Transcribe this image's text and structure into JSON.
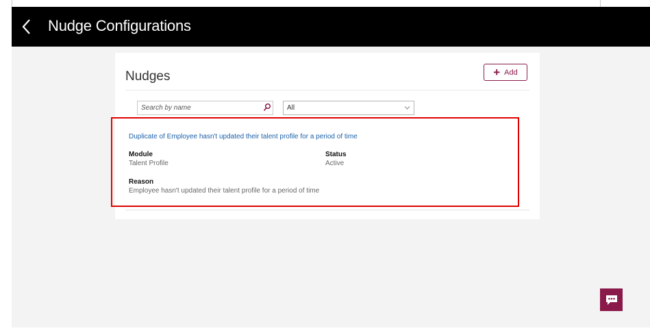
{
  "header": {
    "title": "Nudge Configurations"
  },
  "panel": {
    "title": "Nudges",
    "add_label": "Add"
  },
  "filters": {
    "search_placeholder": "Search by name",
    "status_selected": "All"
  },
  "nudges": [
    {
      "title": "Duplicate of Employee hasn't updated their talent profile for a period of time",
      "module_label": "Module",
      "module_value": "Talent Profile",
      "status_label": "Status",
      "status_value": "Active",
      "reason_label": "Reason",
      "reason_value": "Employee hasn't updated their talent profile for a period of time"
    }
  ],
  "colors": {
    "header_bg": "#000000",
    "accent": "#8a1a4a",
    "link": "#1a5fa8",
    "highlight": "#e00000"
  },
  "icons": {
    "back": "chevron-left-icon",
    "add": "plus-icon",
    "search": "search-icon",
    "dropdown": "chevron-down-icon",
    "chat": "chat-icon"
  }
}
